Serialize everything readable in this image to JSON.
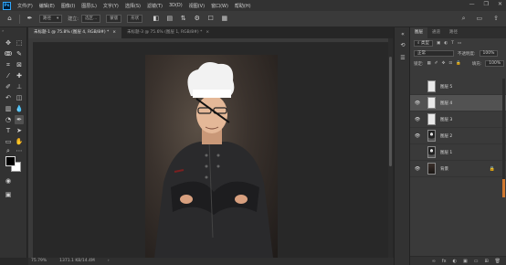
{
  "app": {
    "logo": "Ps"
  },
  "menu": [
    "文件(F)",
    "编辑(E)",
    "图像(I)",
    "图层(L)",
    "文字(Y)",
    "选择(S)",
    "滤镜(T)",
    "3D(D)",
    "视图(V)",
    "窗口(W)",
    "帮助(H)"
  ],
  "window_controls": [
    "—",
    "❐",
    "✕"
  ],
  "options": {
    "mode_label": "路径",
    "build_label": "建立:",
    "selection_label": "选区...",
    "mask_label": "蒙版",
    "shape_label": "形状"
  },
  "tabs": [
    {
      "label": "未标题-1 @ 75.8% (图层 4, RGB/8#) *",
      "close": "×"
    },
    {
      "label": "未标题-3 @ 75.6% (图层 1, RGB/8#) *",
      "close": "×"
    }
  ],
  "status": {
    "zoom": "75.79%",
    "doc_info": "1371.1 KB/14.4M",
    "arrow": "›"
  },
  "panel": {
    "tabs": [
      "图层",
      "通道",
      "路径"
    ],
    "filter_label": "类型",
    "blend_mode": "正常",
    "opacity_label": "不透明度:",
    "opacity_value": "100%",
    "lock_label": "锁定:",
    "fill_label": "填充:",
    "fill_value": "100%",
    "layers": [
      {
        "name": "图层 5",
        "visible": false,
        "thumb": "white",
        "active": false,
        "locked": false
      },
      {
        "name": "图层 4",
        "visible": true,
        "thumb": "white",
        "active": true,
        "locked": false
      },
      {
        "name": "图层 3",
        "visible": true,
        "thumb": "white",
        "active": false,
        "locked": false
      },
      {
        "name": "图层 2",
        "visible": true,
        "thumb": "figure",
        "active": false,
        "locked": false
      },
      {
        "name": "图层 1",
        "visible": false,
        "thumb": "figure",
        "active": false,
        "locked": false
      },
      {
        "name": "背景",
        "visible": true,
        "thumb": "dark",
        "active": false,
        "locked": true
      }
    ],
    "bottom_icons": [
      "∞",
      "fx",
      "◐",
      "▣",
      "▭",
      "⊞",
      "🗑"
    ]
  }
}
